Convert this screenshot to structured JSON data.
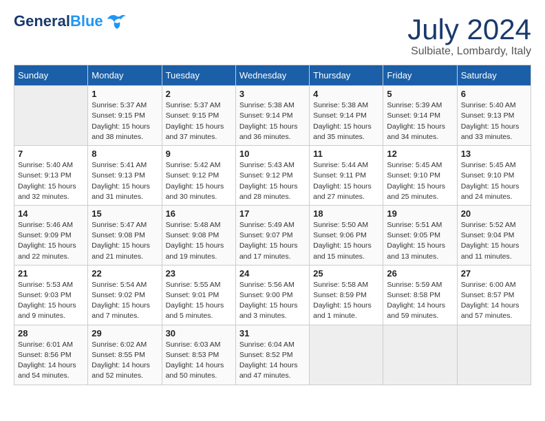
{
  "header": {
    "logo_line1": "General",
    "logo_line2": "Blue",
    "month_year": "July 2024",
    "location": "Sulbiate, Lombardy, Italy"
  },
  "columns": [
    "Sunday",
    "Monday",
    "Tuesday",
    "Wednesday",
    "Thursday",
    "Friday",
    "Saturday"
  ],
  "weeks": [
    [
      {
        "day": "",
        "empty": true
      },
      {
        "day": "1",
        "lines": [
          "Sunrise: 5:37 AM",
          "Sunset: 9:15 PM",
          "Daylight: 15 hours",
          "and 38 minutes."
        ]
      },
      {
        "day": "2",
        "lines": [
          "Sunrise: 5:37 AM",
          "Sunset: 9:15 PM",
          "Daylight: 15 hours",
          "and 37 minutes."
        ]
      },
      {
        "day": "3",
        "lines": [
          "Sunrise: 5:38 AM",
          "Sunset: 9:14 PM",
          "Daylight: 15 hours",
          "and 36 minutes."
        ]
      },
      {
        "day": "4",
        "lines": [
          "Sunrise: 5:38 AM",
          "Sunset: 9:14 PM",
          "Daylight: 15 hours",
          "and 35 minutes."
        ]
      },
      {
        "day": "5",
        "lines": [
          "Sunrise: 5:39 AM",
          "Sunset: 9:14 PM",
          "Daylight: 15 hours",
          "and 34 minutes."
        ]
      },
      {
        "day": "6",
        "lines": [
          "Sunrise: 5:40 AM",
          "Sunset: 9:13 PM",
          "Daylight: 15 hours",
          "and 33 minutes."
        ]
      }
    ],
    [
      {
        "day": "7",
        "lines": [
          "Sunrise: 5:40 AM",
          "Sunset: 9:13 PM",
          "Daylight: 15 hours",
          "and 32 minutes."
        ]
      },
      {
        "day": "8",
        "lines": [
          "Sunrise: 5:41 AM",
          "Sunset: 9:13 PM",
          "Daylight: 15 hours",
          "and 31 minutes."
        ]
      },
      {
        "day": "9",
        "lines": [
          "Sunrise: 5:42 AM",
          "Sunset: 9:12 PM",
          "Daylight: 15 hours",
          "and 30 minutes."
        ]
      },
      {
        "day": "10",
        "lines": [
          "Sunrise: 5:43 AM",
          "Sunset: 9:12 PM",
          "Daylight: 15 hours",
          "and 28 minutes."
        ]
      },
      {
        "day": "11",
        "lines": [
          "Sunrise: 5:44 AM",
          "Sunset: 9:11 PM",
          "Daylight: 15 hours",
          "and 27 minutes."
        ]
      },
      {
        "day": "12",
        "lines": [
          "Sunrise: 5:45 AM",
          "Sunset: 9:10 PM",
          "Daylight: 15 hours",
          "and 25 minutes."
        ]
      },
      {
        "day": "13",
        "lines": [
          "Sunrise: 5:45 AM",
          "Sunset: 9:10 PM",
          "Daylight: 15 hours",
          "and 24 minutes."
        ]
      }
    ],
    [
      {
        "day": "14",
        "lines": [
          "Sunrise: 5:46 AM",
          "Sunset: 9:09 PM",
          "Daylight: 15 hours",
          "and 22 minutes."
        ]
      },
      {
        "day": "15",
        "lines": [
          "Sunrise: 5:47 AM",
          "Sunset: 9:08 PM",
          "Daylight: 15 hours",
          "and 21 minutes."
        ]
      },
      {
        "day": "16",
        "lines": [
          "Sunrise: 5:48 AM",
          "Sunset: 9:08 PM",
          "Daylight: 15 hours",
          "and 19 minutes."
        ]
      },
      {
        "day": "17",
        "lines": [
          "Sunrise: 5:49 AM",
          "Sunset: 9:07 PM",
          "Daylight: 15 hours",
          "and 17 minutes."
        ]
      },
      {
        "day": "18",
        "lines": [
          "Sunrise: 5:50 AM",
          "Sunset: 9:06 PM",
          "Daylight: 15 hours",
          "and 15 minutes."
        ]
      },
      {
        "day": "19",
        "lines": [
          "Sunrise: 5:51 AM",
          "Sunset: 9:05 PM",
          "Daylight: 15 hours",
          "and 13 minutes."
        ]
      },
      {
        "day": "20",
        "lines": [
          "Sunrise: 5:52 AM",
          "Sunset: 9:04 PM",
          "Daylight: 15 hours",
          "and 11 minutes."
        ]
      }
    ],
    [
      {
        "day": "21",
        "lines": [
          "Sunrise: 5:53 AM",
          "Sunset: 9:03 PM",
          "Daylight: 15 hours",
          "and 9 minutes."
        ]
      },
      {
        "day": "22",
        "lines": [
          "Sunrise: 5:54 AM",
          "Sunset: 9:02 PM",
          "Daylight: 15 hours",
          "and 7 minutes."
        ]
      },
      {
        "day": "23",
        "lines": [
          "Sunrise: 5:55 AM",
          "Sunset: 9:01 PM",
          "Daylight: 15 hours",
          "and 5 minutes."
        ]
      },
      {
        "day": "24",
        "lines": [
          "Sunrise: 5:56 AM",
          "Sunset: 9:00 PM",
          "Daylight: 15 hours",
          "and 3 minutes."
        ]
      },
      {
        "day": "25",
        "lines": [
          "Sunrise: 5:58 AM",
          "Sunset: 8:59 PM",
          "Daylight: 15 hours",
          "and 1 minute."
        ]
      },
      {
        "day": "26",
        "lines": [
          "Sunrise: 5:59 AM",
          "Sunset: 8:58 PM",
          "Daylight: 14 hours",
          "and 59 minutes."
        ]
      },
      {
        "day": "27",
        "lines": [
          "Sunrise: 6:00 AM",
          "Sunset: 8:57 PM",
          "Daylight: 14 hours",
          "and 57 minutes."
        ]
      }
    ],
    [
      {
        "day": "28",
        "lines": [
          "Sunrise: 6:01 AM",
          "Sunset: 8:56 PM",
          "Daylight: 14 hours",
          "and 54 minutes."
        ]
      },
      {
        "day": "29",
        "lines": [
          "Sunrise: 6:02 AM",
          "Sunset: 8:55 PM",
          "Daylight: 14 hours",
          "and 52 minutes."
        ]
      },
      {
        "day": "30",
        "lines": [
          "Sunrise: 6:03 AM",
          "Sunset: 8:53 PM",
          "Daylight: 14 hours",
          "and 50 minutes."
        ]
      },
      {
        "day": "31",
        "lines": [
          "Sunrise: 6:04 AM",
          "Sunset: 8:52 PM",
          "Daylight: 14 hours",
          "and 47 minutes."
        ]
      },
      {
        "day": "",
        "empty": true
      },
      {
        "day": "",
        "empty": true
      },
      {
        "day": "",
        "empty": true
      }
    ]
  ]
}
